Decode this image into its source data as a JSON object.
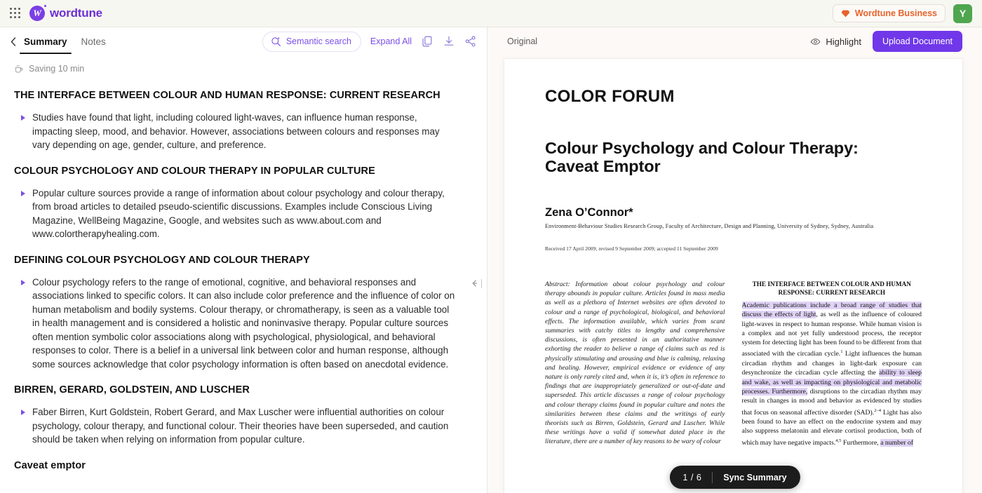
{
  "topbar": {
    "apps_icon": "apps-grid-icon",
    "brand_name": "wordtune",
    "brand_mark_letter": "W",
    "business_badge": {
      "label": "Wordtune Business",
      "icon": "gem-icon",
      "color": "#E8622C"
    },
    "avatar_initial": "Y",
    "avatar_color": "#4FA64F"
  },
  "summary_panel": {
    "back_icon": "chevron-left-icon",
    "tabs": [
      {
        "label": "Summary",
        "active": true
      },
      {
        "label": "Notes",
        "active": false
      }
    ],
    "semantic_search": {
      "label": "Semantic search",
      "icon": "search-sparkle-icon"
    },
    "expand_all_label": "Expand All",
    "icons": [
      "copy-icon",
      "download-icon",
      "share-icon"
    ],
    "saving_status": {
      "icon": "coffee-icon",
      "text": "Saving 10 min"
    },
    "collapse_handle_icon": "collapse-panel-icon",
    "sections": [
      {
        "heading": "THE INTERFACE BETWEEN COLOUR AND HUMAN RESPONSE: CURRENT RESEARCH",
        "bullets": [
          "Studies have found that light, including coloured light-waves, can influence human response, impacting sleep, mood, and behavior. However, associations between colours and responses may vary depending on age, gender, culture, and preference."
        ]
      },
      {
        "heading": "COLOUR PSYCHOLOGY AND COLOUR THERAPY IN POPULAR CULTURE",
        "bullets": [
          "Popular culture sources provide a range of information about colour psychology and colour therapy, from broad articles to detailed pseudo-scientific discussions. Examples include Conscious Living Magazine, WellBeing Magazine, Google, and websites such as www.about.com and www.colortherapyhealing.com."
        ]
      },
      {
        "heading": "DEFINING COLOUR PSYCHOLOGY AND COLOUR THERAPY",
        "bullets": [
          "Colour psychology refers to the range of emotional, cognitive, and behavioral responses and associations linked to specific colors. It can also include color preference and the influence of color on human metabolism and bodily systems. Colour therapy, or chromatherapy, is seen as a valuable tool in health management and is considered a holistic and noninvasive therapy. Popular culture sources often mention symbolic color associations along with psychological, physiological, and behavioral responses to color. There is a belief in a universal link between color and human response, although some sources acknowledge that color psychology information is often based on anecdotal evidence."
        ]
      },
      {
        "heading": "BIRREN, GERARD, GOLDSTEIN, AND LUSCHER",
        "bullets": [
          "Faber Birren, Kurt Goldstein, Robert Gerard, and Max Luscher were influential authorities on colour psychology, colour therapy, and functional colour. Their theories have been superseded, and caution should be taken when relying on information from popular culture."
        ]
      },
      {
        "heading": "Caveat emptor",
        "bullets": []
      }
    ]
  },
  "document_panel": {
    "view_label": "Original",
    "highlight_button": {
      "label": "Highlight",
      "icon": "eye-icon"
    },
    "upload_button": {
      "label": "Upload Document",
      "color": "#7038E8"
    },
    "page_indicator": {
      "current": "1",
      "separator": "/",
      "total": "6",
      "sync_label": "Sync Summary"
    },
    "paper": {
      "journal": "COLOR FORUM",
      "title": "Colour Psychology and Colour Therapy: Caveat Emptor",
      "author": "Zena O’Connor*",
      "affiliation": "Environment-Behaviour Studies Research Group, Faculty of Architecture, Design and Planning, University of Sydney, Sydney, Australia",
      "received": "Received 17 April 2009; revised 9 September 2009; accepted 11 September 2009",
      "abstract": "Abstract: Information about colour psychology and colour therapy abounds in popular culture. Articles found in mass media as well as a plethora of Internet websites are often devoted to colour and a range of psychological, biological, and behavioral effects. The information available, which varies from scant summaries with catchy titles to lengthy and comprehensive discussions, is often presented in an authoritative manner exhorting the reader to believe a range of claims such as red is physically stimulating and arousing and blue is calming, relaxing and healing. However, empirical evidence or evidence of any nature is only rarely cited and, when it is, it’s often in reference to findings that are inappropriately generalized or out-of-date and superseded. This article discusses a range of colour psychology and colour therapy claims found in popular culture and notes the similarities between these claims and the writings of early theorists such as Birren, Goldstein, Gerard and Luscher. While these writings have a valid if somewhat dated place in the literature, there are a number of key reasons to be wary of colour",
      "right_column_heading": "THE INTERFACE BETWEEN COLOUR AND HUMAN RESPONSE: CURRENT RESEARCH",
      "right_column_segments": [
        {
          "text": "Academic publications include a broad range of studies that discuss the effects of light",
          "highlighted": true
        },
        {
          "text": ", as well as the influence of coloured light-waves in respect to human response. While human vision is a complex and not yet fully understood process, the receptor system for detecting light has been found to be different from that associated with the circadian cycle.",
          "highlighted": false
        },
        {
          "text": "1",
          "superscript": true
        },
        {
          "text": " Light influences the human circadian rhythm and changes in light-dark exposure can desynchronize the circadian cycle affecting the ",
          "highlighted": false
        },
        {
          "text": "ability to sleep and wake, as well as impacting on physiological and metabolic processes. Furthermore,",
          "highlighted": true
        },
        {
          "text": " disruptions to the circadian rhythm may result in changes in mood and behavior as evidenced by studies that focus on seasonal affective disorder (SAD).",
          "highlighted": false
        },
        {
          "text": "2–4",
          "superscript": true
        },
        {
          "text": " Light has also been found to have an effect on the endocrine system and may also suppress melatonin and elevate cortisol production, both of which may have negative impacts.",
          "highlighted": false
        },
        {
          "text": "4,5",
          "superscript": true
        },
        {
          "text": " Furthermore, ",
          "highlighted": false
        },
        {
          "text": "a number of",
          "highlighted": true
        }
      ]
    }
  }
}
